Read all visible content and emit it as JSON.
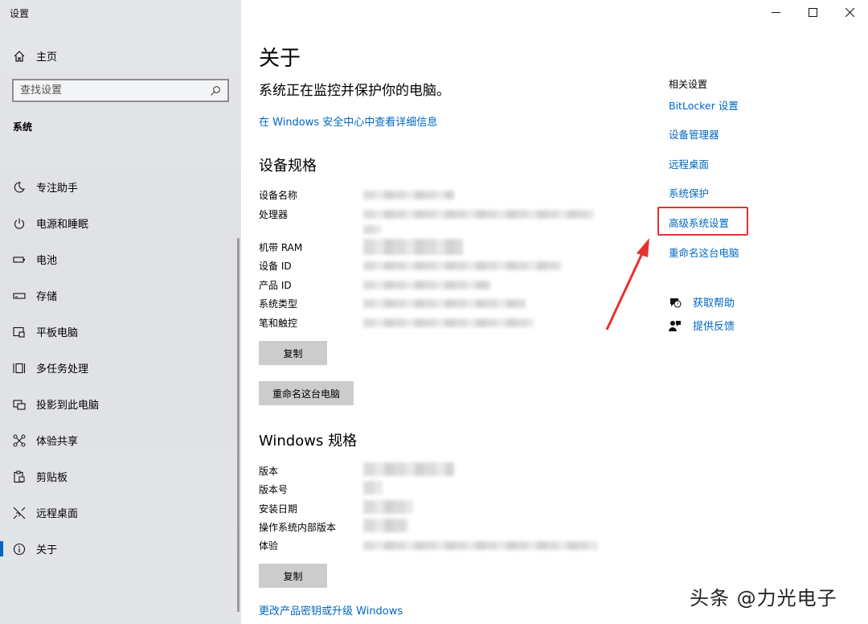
{
  "window": {
    "title": "设置"
  },
  "sidebar": {
    "home": "主页",
    "search_placeholder": "查找设置",
    "section": "系统",
    "items": [
      {
        "label": "专注助手",
        "icon": "moon-icon"
      },
      {
        "label": "电源和睡眠",
        "icon": "power-icon"
      },
      {
        "label": "电池",
        "icon": "battery-icon"
      },
      {
        "label": "存储",
        "icon": "storage-icon"
      },
      {
        "label": "平板电脑",
        "icon": "tablet-icon"
      },
      {
        "label": "多任务处理",
        "icon": "multitask-icon"
      },
      {
        "label": "投影到此电脑",
        "icon": "project-icon"
      },
      {
        "label": "体验共享",
        "icon": "share-icon"
      },
      {
        "label": "剪贴板",
        "icon": "clipboard-icon"
      },
      {
        "label": "远程桌面",
        "icon": "remote-icon"
      },
      {
        "label": "关于",
        "icon": "info-icon",
        "active": true
      }
    ]
  },
  "main": {
    "title": "关于",
    "status": "系统正在监控并保护你的电脑。",
    "security_link": "在 Windows 安全中心中查看详细信息",
    "device_spec_heading": "设备规格",
    "device_specs": [
      "设备名称",
      "处理器",
      "机带 RAM",
      "设备 ID",
      "产品 ID",
      "系统类型",
      "笔和触控"
    ],
    "copy_button": "复制",
    "rename_button": "重命名这台电脑",
    "windows_spec_heading": "Windows 规格",
    "windows_specs": [
      "版本",
      "版本号",
      "安装日期",
      "操作系统内部版本",
      "体验"
    ],
    "copy_button_2": "复制",
    "upgrade_link": "更改产品密钥或升级 Windows"
  },
  "related": {
    "title": "相关设置",
    "links": [
      "BitLocker 设置",
      "设备管理器",
      "远程桌面",
      "系统保护",
      "高级系统设置",
      "重命名这台电脑"
    ],
    "help": "获取帮助",
    "feedback": "提供反馈"
  },
  "watermark": "头条 @力光电子",
  "colors": {
    "accent": "#0067c0",
    "highlight": "#e6322e"
  }
}
